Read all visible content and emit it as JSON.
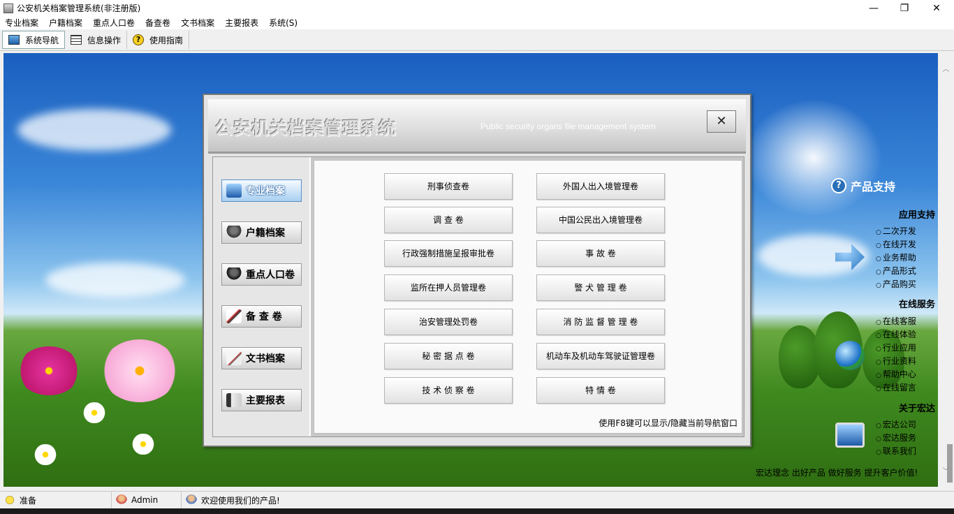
{
  "window": {
    "title": "公安机关档案管理系统(非注册版)",
    "minimize": "—",
    "maximize": "❐",
    "close": "✕"
  },
  "menu": [
    "专业档案",
    "户籍档案",
    "重点人口卷",
    "备查卷",
    "文书档案",
    "主要报表",
    "系统(S)"
  ],
  "toolbar": {
    "nav": "系统导航",
    "info": "信息操作",
    "guide": "使用指南"
  },
  "dialog": {
    "title": "公安机关档案管理系统",
    "subtitle": "Public security organs file management system",
    "close": "✕",
    "nav": [
      "专业档案",
      "户籍档案",
      "重点人口卷",
      "备 查 卷",
      "文书档案",
      "主要报表"
    ],
    "left_buttons": [
      "刑事侦查卷",
      "调 查 卷",
      "行政强制措施呈报审批卷",
      "监所在押人员管理卷",
      "治安管理处罚卷",
      "秘 密 据 点 卷",
      "技 术 侦 察 卷"
    ],
    "right_buttons": [
      "外国人出入境管理卷",
      "中国公民出入境管理卷",
      "事 故 卷",
      "警 犬 管 理 卷",
      "消 防 监 督 管 理 卷",
      "机动车及机动车驾驶证管理卷",
      "特 情 卷"
    ],
    "hint": "使用F8键可以显示/隐藏当前导航窗口"
  },
  "support": {
    "header": "产品支持",
    "sections": [
      {
        "title": "应用支持",
        "links": [
          "二次开发",
          "在线开发",
          "业务帮助",
          "产品形式",
          "产品购买"
        ]
      },
      {
        "title": "在线服务",
        "links": [
          "在线客服",
          "在线体验",
          "行业应用",
          "行业资料",
          "帮助中心",
          "在线留言"
        ]
      },
      {
        "title": "关于宏达",
        "links": [
          "宏达公司",
          "宏达服务",
          "联系我们"
        ]
      }
    ],
    "slogan": "宏达理念 出好产品 做好服务 提升客户价值!"
  },
  "status": {
    "ready": "准备",
    "user": "Admin",
    "welcome": "欢迎使用我们的产品!"
  },
  "colors": {
    "selected_nav": "#a9d0f2",
    "sky": "#3a86d8",
    "grass": "#3f8a1f"
  }
}
